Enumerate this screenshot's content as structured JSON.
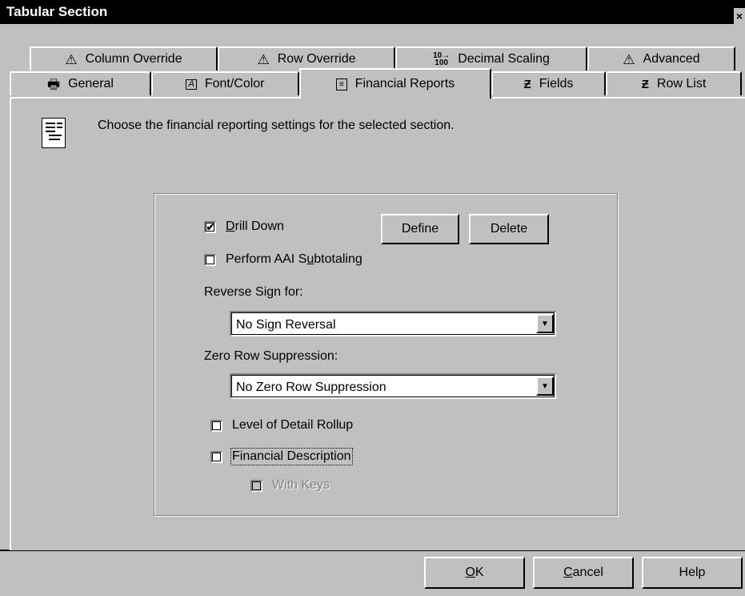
{
  "window": {
    "title": "Tabular Section",
    "close_glyph": "×"
  },
  "tabs_back": [
    {
      "label": "Column Override",
      "icon": "warning-icon"
    },
    {
      "label": "Row Override",
      "icon": "warning-icon"
    },
    {
      "label": "Decimal Scaling",
      "icon": "decimal-scaling-icon"
    },
    {
      "label": "Advanced",
      "icon": "warning-icon"
    }
  ],
  "tabs_front": [
    {
      "label": "General",
      "icon": "printer-icon"
    },
    {
      "label": "Font/Color",
      "icon": "font-icon"
    },
    {
      "label": "Financial Reports",
      "icon": "report-icon",
      "active": true
    },
    {
      "label": "Fields",
      "icon": "fields-icon"
    },
    {
      "label": "Row List",
      "icon": "row-list-icon"
    }
  ],
  "instruction": "Choose the financial reporting settings for the selected section.",
  "drill_down": {
    "label_mnemonic": "D",
    "label_rest": "rill Down",
    "checked": true
  },
  "define_label": "Define",
  "delete_label": "Delete",
  "aai": {
    "label_pre": "Perform AAI S",
    "label_mnemonic": "u",
    "label_post": "btotaling",
    "checked": false
  },
  "reverse_sign": {
    "label": "Reverse Sign for:",
    "value": "No Sign Reversal"
  },
  "zero_row": {
    "label": "Zero Row Suppression:",
    "value": "No Zero Row Suppression"
  },
  "level_detail": {
    "label": "Level of Detail Rollup",
    "checked": false
  },
  "financial_description": {
    "label": "Financial Description",
    "checked": false
  },
  "with_keys": {
    "label": "With Keys",
    "checked": false,
    "disabled": true
  },
  "buttons": {
    "ok": {
      "mnemonic": "O",
      "rest": "K"
    },
    "cancel": {
      "mnemonic": "C",
      "rest": "ancel"
    },
    "help": "Help"
  },
  "glyphs": {
    "warning": "⚠",
    "printer": "🖶",
    "check": "✔",
    "arrow": "▼"
  }
}
